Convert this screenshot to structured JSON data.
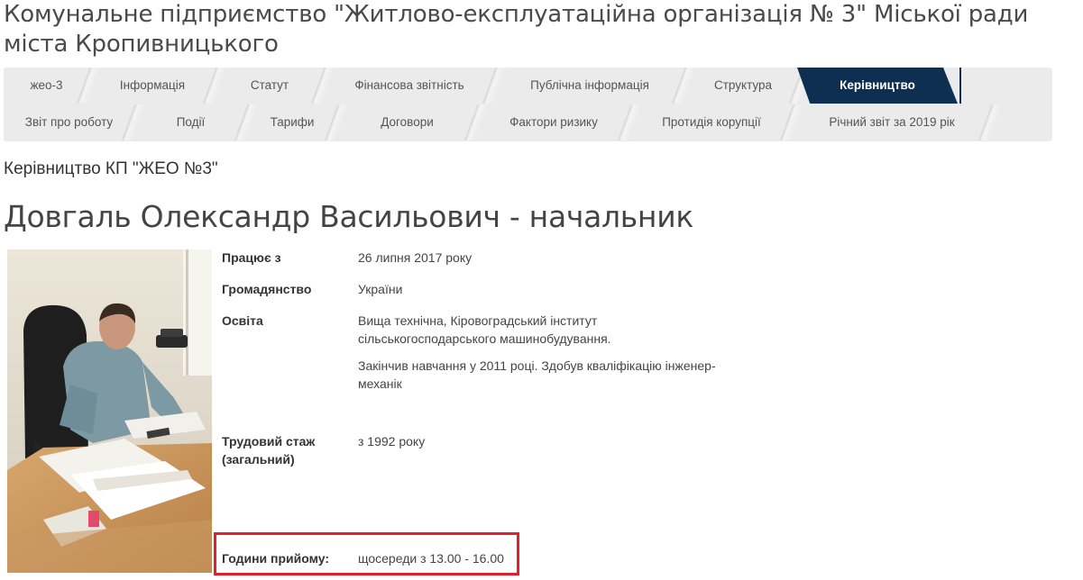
{
  "header": {
    "title": "Комунальне підприємство \"Житлово-експлуатаційна організація № 3\" Міської ради міста Кропивницького"
  },
  "nav": {
    "row1": [
      {
        "label": "жео-3"
      },
      {
        "label": "Інформація"
      },
      {
        "label": "Статут"
      },
      {
        "label": "Фінансова звітність"
      },
      {
        "label": "Публічна інформація"
      },
      {
        "label": "Структура"
      },
      {
        "label": "Керівництво",
        "active": true
      }
    ],
    "row2": [
      {
        "label": "Звіт про роботу"
      },
      {
        "label": "Події"
      },
      {
        "label": "Тарифи"
      },
      {
        "label": "Договори"
      },
      {
        "label": "Фактори ризику"
      },
      {
        "label": "Протидія корупції"
      },
      {
        "label": "Річний звіт за 2019 рік"
      }
    ],
    "active_color": "#0e2f52"
  },
  "main": {
    "section_title": "Керівництво КП \"ЖЕО №3\"",
    "person_name": "Довгаль Олександр Васильович - начальник",
    "details": {
      "works_since_label": "Працює з",
      "works_since_value": "26 липня 2017 року",
      "citizenship_label": "Громадянство",
      "citizenship_value": "України",
      "education_label": "Освіта",
      "education_value_1_line1": "Вища технічна, Кіровоградський інститут",
      "education_value_1_line2": "сільськогосподарського машинобудування.",
      "education_value_2_line1": "Закінчив навчання у 2011 році. Здобув кваліфікацію інженер-",
      "education_value_2_line2": "механік",
      "experience_label_line1": "Трудовий стаж",
      "experience_label_line2": "(загальний)",
      "experience_value": "з 1992 року",
      "reception_label": "Години прийому:",
      "reception_value": "щосереди з 13.00 - 16.00"
    },
    "highlight_color": "#e0202a"
  }
}
